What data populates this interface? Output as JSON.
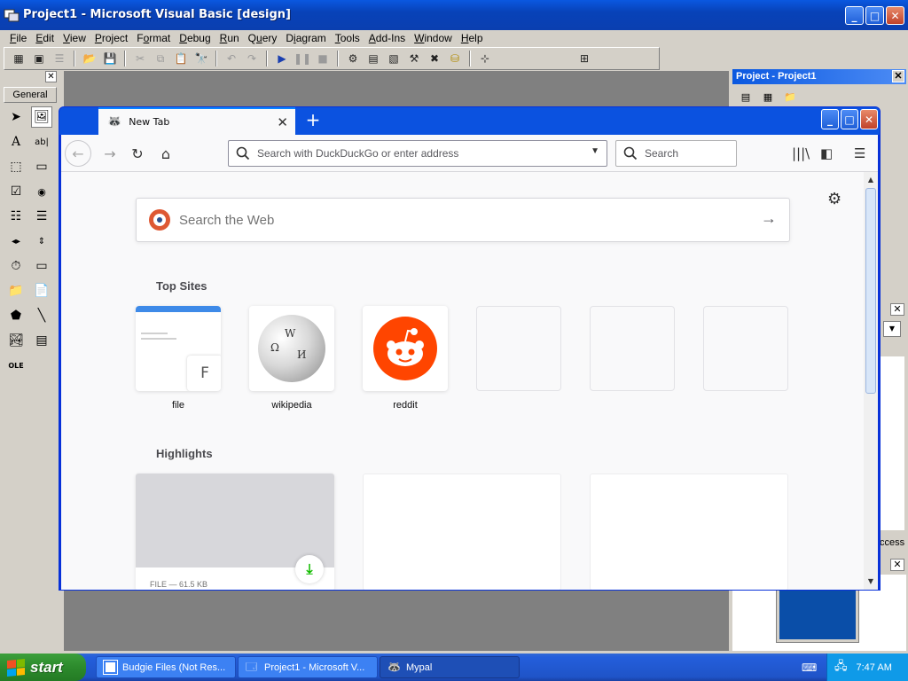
{
  "vb": {
    "title": "Project1 - Microsoft Visual Basic [design]",
    "menu": [
      {
        "pre": "",
        "u": "F",
        "post": "ile"
      },
      {
        "pre": "",
        "u": "E",
        "post": "dit"
      },
      {
        "pre": "",
        "u": "V",
        "post": "iew"
      },
      {
        "pre": "",
        "u": "P",
        "post": "roject"
      },
      {
        "pre": "F",
        "u": "o",
        "post": "rmat"
      },
      {
        "pre": "",
        "u": "D",
        "post": "ebug"
      },
      {
        "pre": "",
        "u": "R",
        "post": "un"
      },
      {
        "pre": "Q",
        "u": "u",
        "post": "ery"
      },
      {
        "pre": "D",
        "u": "i",
        "post": "agram"
      },
      {
        "pre": "",
        "u": "T",
        "post": "ools"
      },
      {
        "pre": "",
        "u": "A",
        "post": "dd-Ins"
      },
      {
        "pre": "",
        "u": "W",
        "post": "indow"
      },
      {
        "pre": "",
        "u": "H",
        "post": "elp"
      }
    ],
    "toolbox_tab": "General",
    "project_panel_title": "Project - Project1",
    "side_partial_text": "ccess"
  },
  "firefox": {
    "tab_title": "New Tab",
    "url_placeholder": "Search with DuckDuckGo or enter address",
    "search_placeholder": "Search",
    "web_search_placeholder": "Search the Web",
    "top_sites_heading": "Top Sites",
    "top_sites": [
      {
        "label": "file",
        "badge": "F"
      },
      {
        "label": "wikipedia"
      },
      {
        "label": "reddit"
      }
    ],
    "highlights_heading": "Highlights",
    "highlight_meta": "FILE — 61.5 KB"
  },
  "taskbar": {
    "start_label": "start",
    "tasks": [
      "Budgie Files (Not Res...",
      "Project1 - Microsoft V...",
      "Mypal"
    ],
    "clock": "7:47 AM"
  },
  "colors": {
    "xp_blue": "#0a58e0",
    "taskbar_blue": "#245edb",
    "start_green": "#2c8a2c",
    "reddit": "#ff4500",
    "duckduckgo": "#de5833"
  }
}
